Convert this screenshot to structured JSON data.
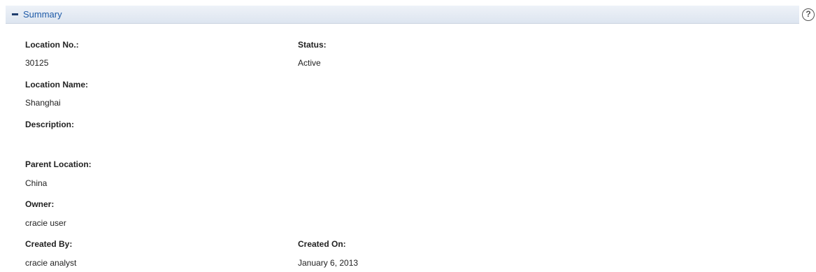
{
  "summary": {
    "title": "Summary",
    "help_icon": "help-circle-icon",
    "collapse_icon": "minus-icon"
  },
  "fields": {
    "location_no": {
      "label": "Location No.:",
      "value": "30125"
    },
    "status": {
      "label": "Status:",
      "value": "Active"
    },
    "location_name": {
      "label": "Location Name:",
      "value": "Shanghai"
    },
    "description": {
      "label": "Description:",
      "value": ""
    },
    "parent_location": {
      "label": "Parent Location:",
      "value": "China"
    },
    "owner": {
      "label": "Owner:",
      "value": "cracie user"
    },
    "created_by": {
      "label": "Created By:",
      "value": "cracie analyst"
    },
    "created_on": {
      "label": "Created On:",
      "value": "January 6, 2013"
    }
  },
  "colors": {
    "header_bg": "#dde5f0",
    "title_link": "#1f5ba8"
  }
}
